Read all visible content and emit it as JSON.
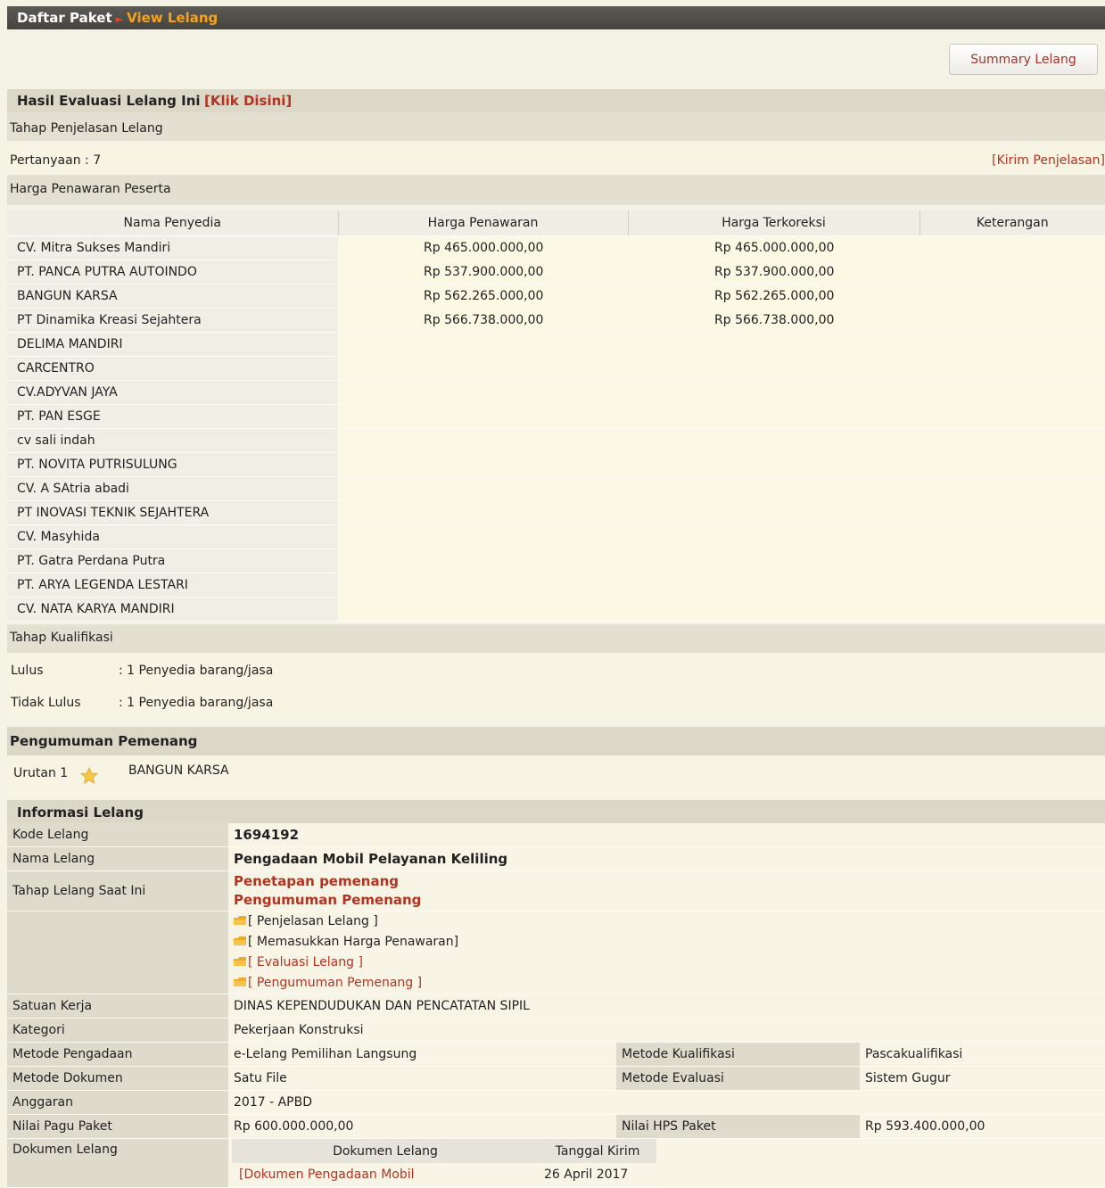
{
  "breadcrumb": {
    "item1": "Daftar Paket",
    "item2": "View Lelang"
  },
  "summary_button": "Summary Lelang",
  "hasil_evaluasi": {
    "label": "Hasil Evaluasi Lelang Ini",
    "link": "[Klik Disini]"
  },
  "penjelasan": {
    "title": "Tahap Penjelasan Lelang",
    "pertanyaan": "Pertanyaan : 7",
    "kirim_link": "[Kirim Penjelasan]"
  },
  "harga": {
    "title": "Harga Penawaran Peserta",
    "headers": [
      "Nama Penyedia",
      "Harga Penawaran",
      "Harga Terkoreksi",
      "Keterangan"
    ],
    "rows": [
      {
        "name": "CV. Mitra Sukses Mandiri",
        "penawaran": "Rp 465.000.000,00",
        "terkoreksi": "Rp 465.000.000,00",
        "ket": ""
      },
      {
        "name": "PT. PANCA PUTRA AUTOINDO",
        "penawaran": "Rp 537.900.000,00",
        "terkoreksi": "Rp 537.900.000,00",
        "ket": ""
      },
      {
        "name": "BANGUN KARSA",
        "penawaran": "Rp 562.265.000,00",
        "terkoreksi": "Rp 562.265.000,00",
        "ket": ""
      },
      {
        "name": "PT Dinamika Kreasi Sejahtera",
        "penawaran": "Rp 566.738.000,00",
        "terkoreksi": "Rp 566.738.000,00",
        "ket": ""
      },
      {
        "name": "DELIMA MANDIRI",
        "penawaran": "",
        "terkoreksi": "",
        "ket": ""
      },
      {
        "name": "CARCENTRO",
        "penawaran": "",
        "terkoreksi": "",
        "ket": ""
      },
      {
        "name": "CV.ADYVAN JAYA",
        "penawaran": "",
        "terkoreksi": "",
        "ket": ""
      },
      {
        "name": "PT. PAN ESGE",
        "penawaran": "",
        "terkoreksi": "",
        "ket": ""
      },
      {
        "name": "cv sali indah",
        "penawaran": "",
        "terkoreksi": "",
        "ket": ""
      },
      {
        "name": "PT. NOVITA PUTRISULUNG",
        "penawaran": "",
        "terkoreksi": "",
        "ket": ""
      },
      {
        "name": "CV. A SAtria abadi",
        "penawaran": "",
        "terkoreksi": "",
        "ket": ""
      },
      {
        "name": "PT INOVASI TEKNIK SEJAHTERA",
        "penawaran": "",
        "terkoreksi": "",
        "ket": ""
      },
      {
        "name": "CV. Masyhida",
        "penawaran": "",
        "terkoreksi": "",
        "ket": ""
      },
      {
        "name": "PT. Gatra Perdana Putra",
        "penawaran": "",
        "terkoreksi": "",
        "ket": ""
      },
      {
        "name": "PT. ARYA LEGENDA LESTARI",
        "penawaran": "",
        "terkoreksi": "",
        "ket": ""
      },
      {
        "name": "CV. NATA KARYA MANDIRI",
        "penawaran": "",
        "terkoreksi": "",
        "ket": ""
      }
    ]
  },
  "kualifikasi": {
    "title": "Tahap Kualifikasi",
    "lulus_label": "Lulus",
    "lulus_value": ": 1  Penyedia barang/jasa",
    "tidak_label": "Tidak Lulus",
    "tidak_value": ": 1  Penyedia barang/jasa"
  },
  "pemenang": {
    "title": "Pengumuman Pemenang",
    "urutan": "Urutan 1",
    "name": "BANGUN KARSA",
    "icon": "star-icon"
  },
  "informasi": {
    "title": "Informasi Lelang",
    "kode_label": "Kode Lelang",
    "kode_value": "1694192",
    "nama_label": "Nama Lelang",
    "nama_value": "Pengadaan Mobil Pelayanan Keliling",
    "tahap_label": "Tahap Lelang Saat Ini",
    "tahap_value1": "Penetapan pemenang",
    "tahap_value2": "Pengumuman Pemenang",
    "links": [
      "[ Penjelasan Lelang ]",
      "[ Memasukkan Harga Penawaran]",
      "[ Evaluasi Lelang ]",
      "[ Pengumuman Pemenang ]"
    ],
    "satuan_label": "Satuan Kerja",
    "satuan_value": "DINAS KEPENDUDUKAN DAN PENCATATAN SIPIL",
    "kategori_label": "Kategori",
    "kategori_value": "Pekerjaan Konstruksi",
    "metode_pengadaan_label": "Metode Pengadaan",
    "metode_pengadaan_value": "e-Lelang Pemilihan Langsung",
    "metode_kualifikasi_label": "Metode Kualifikasi",
    "metode_kualifikasi_value": "Pascakualifikasi",
    "metode_dokumen_label": "Metode Dokumen",
    "metode_dokumen_value": "Satu File",
    "metode_evaluasi_label": "Metode Evaluasi",
    "metode_evaluasi_value": "Sistem Gugur",
    "anggaran_label": "Anggaran",
    "anggaran_value": "2017 - APBD",
    "pagu_label": "Nilai Pagu Paket",
    "pagu_value": "Rp 600.000.000,00",
    "hps_label": "Nilai HPS Paket",
    "hps_value": "Rp 593.400.000,00",
    "dokumen_label": "Dokumen Lelang",
    "dokumen_headers": [
      "Dokumen Lelang",
      "Tanggal Kirim"
    ],
    "dokumen_row": {
      "name": "[Dokumen Pengadaan Mobil",
      "date": "26 April 2017"
    }
  },
  "colors": {
    "accent_red": "#b5321f",
    "breadcrumb_orange": "#f4a21f",
    "header_bar": "#4f4d48",
    "section_bg": "#dcd8c8"
  }
}
